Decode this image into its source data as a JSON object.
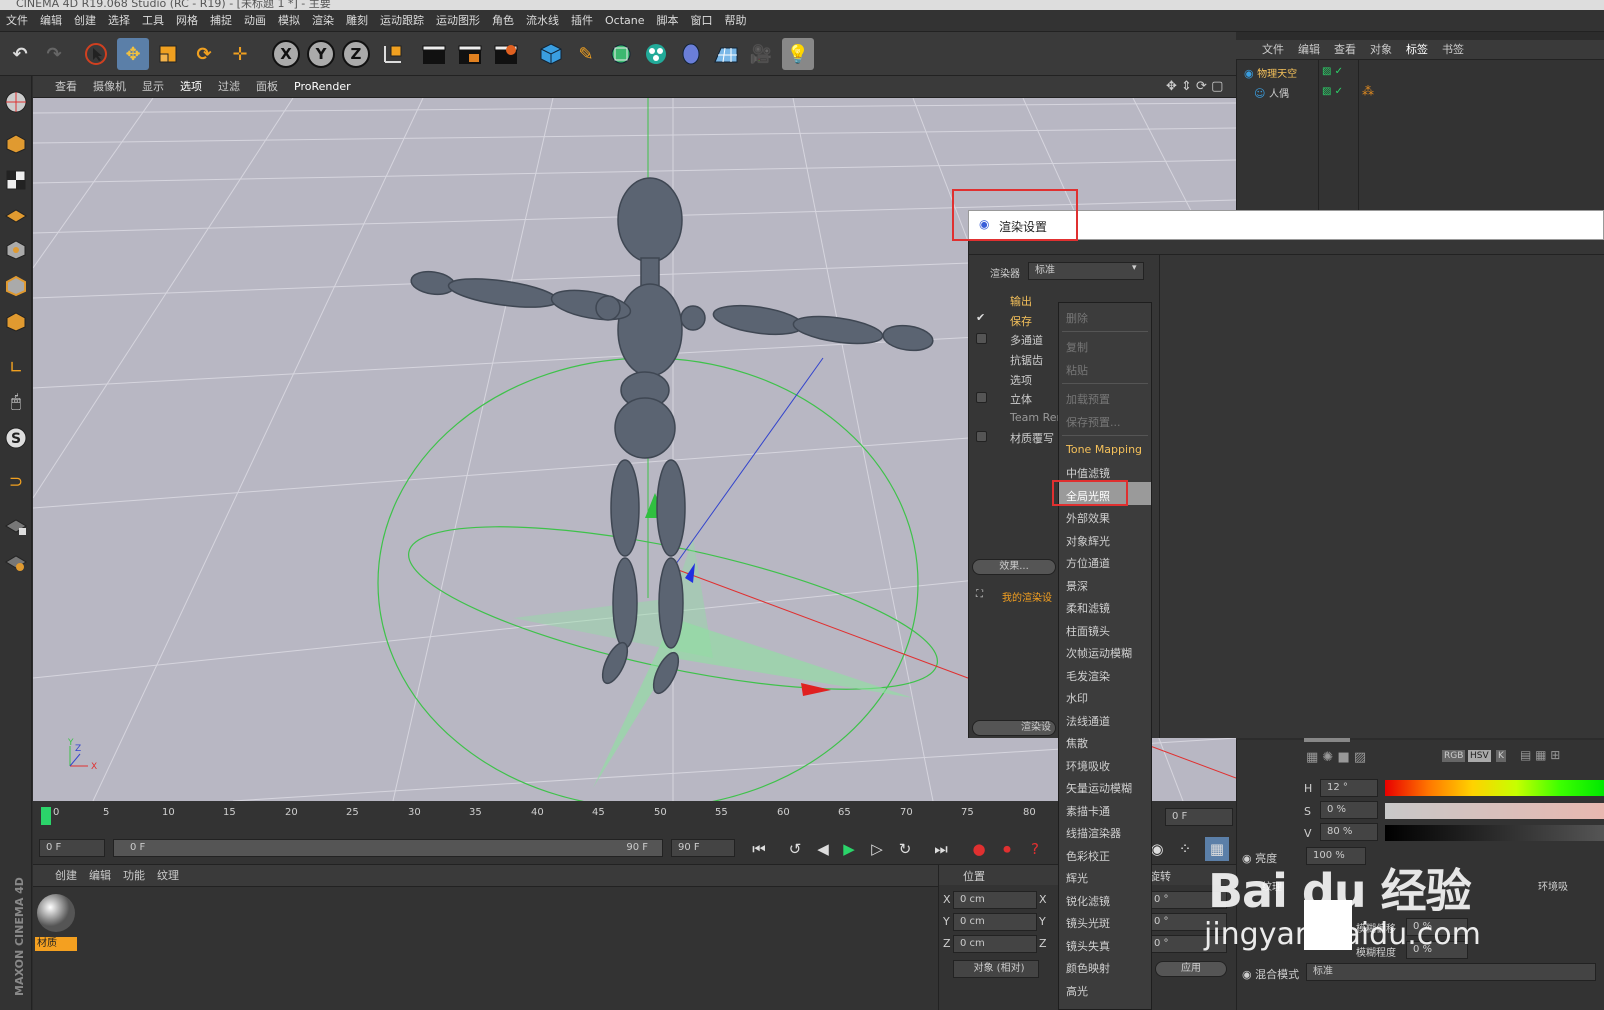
{
  "window": {
    "title": "CINEMA 4D R19.068 Studio (RC - R19) - [未标题 1 *] - 主要"
  },
  "menubar": [
    "文件",
    "编辑",
    "创建",
    "选择",
    "工具",
    "网格",
    "捕捉",
    "动画",
    "模拟",
    "渲染",
    "雕刻",
    "运动跟踪",
    "运动图形",
    "角色",
    "流水线",
    "插件",
    "Octane",
    "脚本",
    "窗口",
    "帮助"
  ],
  "toolbar": {
    "axis_labels": [
      "X",
      "Y",
      "Z"
    ]
  },
  "viewport": {
    "menu": [
      "查看",
      "摄像机",
      "显示",
      "选项",
      "过滤",
      "面板",
      "ProRender"
    ],
    "active_menu": "选项",
    "axis_gizmo": {
      "y": "Y",
      "z": "Z",
      "x": "X"
    }
  },
  "timeline": {
    "ticks": [
      "0",
      "5",
      "10",
      "15",
      "20",
      "25",
      "30",
      "35",
      "40",
      "45",
      "50",
      "55",
      "60",
      "65",
      "70",
      "75",
      "80"
    ],
    "current_frame": "0 F",
    "start_field": "0 F",
    "range_start": "0 F",
    "range_end": "90 F",
    "end_field": "90 F",
    "right_field": "0 F"
  },
  "material_panel": {
    "menu": [
      "创建",
      "编辑",
      "功能",
      "纹理"
    ],
    "material_label": "材质",
    "brand": "MAXON CINEMA 4D"
  },
  "coordinates": {
    "header_pos": "位置",
    "header_rot": "旋转",
    "rows": [
      {
        "axis": "X",
        "value": "0 cm",
        "axis2": "X",
        "rot": "0 °"
      },
      {
        "axis": "Y",
        "value": "0 cm",
        "axis2": "Y",
        "rot": "0 °"
      },
      {
        "axis": "Z",
        "value": "0 cm",
        "axis2": "Z",
        "rot": "0 °"
      }
    ],
    "mode": "对象 (相对)",
    "apply": "应用"
  },
  "object_manager": {
    "menu": [
      "文件",
      "编辑",
      "查看",
      "对象",
      "标签",
      "书签"
    ],
    "active_menu": "标签",
    "objects": [
      {
        "name": "物理天空",
        "highlight": true
      },
      {
        "name": "人偶",
        "highlight": false
      }
    ]
  },
  "render_settings": {
    "title": "渲染设置",
    "renderer_label": "渲染器",
    "renderer_value": "标准",
    "items": [
      {
        "label": "输出",
        "checked": null,
        "active": true
      },
      {
        "label": "保存",
        "checked": true,
        "active": true
      },
      {
        "label": "多通道",
        "checked": false,
        "active": false
      },
      {
        "label": "抗锯齿",
        "checked": null,
        "active": false
      },
      {
        "label": "选项",
        "checked": null,
        "active": false
      },
      {
        "label": "立体",
        "checked": false,
        "active": false
      },
      {
        "label": "Team Rer",
        "checked": null,
        "active": false
      },
      {
        "label": "材质覆写",
        "checked": false,
        "active": false
      }
    ],
    "effects_button": "效果...",
    "preset_name": "我的渲染设",
    "render_button": "渲染设"
  },
  "context_menu": {
    "group1": [
      "删除",
      "复制",
      "粘贴",
      "加载预置",
      "保存预置..."
    ],
    "tone_mapping": "Tone Mapping",
    "effects": [
      "中值滤镜",
      "全局光照",
      "外部效果",
      "对象辉光",
      "方位通道",
      "景深",
      "柔和滤镜",
      "柱面镜头",
      "次帧运动模糊",
      "毛发渲染",
      "水印",
      "法线通道",
      "焦散",
      "环境吸收",
      "矢量运动模糊",
      "素描卡通",
      "线描渲染器",
      "色彩校正",
      "辉光",
      "锐化滤镜",
      "镜头光斑",
      "镜头失真",
      "颜色映射",
      "高光"
    ],
    "highlighted": "全局光照"
  },
  "attributes": {
    "H_label": "H",
    "H_value": "12 °",
    "S_label": "S",
    "S_value": "0 %",
    "V_label": "V",
    "V_value": "80 %",
    "brightness_label": "亮度",
    "brightness_value": "100 %",
    "tex_label": "纹理",
    "env_label": "环境吸",
    "blur_offset_label": "模糊偏移",
    "blur_offset_value": "0 %",
    "blur_label": "模糊程度",
    "blur_value": "0 %",
    "blend_label": "混合模式",
    "blend_value": "标准",
    "mode_buttons": [
      "RGB",
      "HSV",
      "K"
    ]
  },
  "watermark": {
    "brand": "Bai du 经验",
    "url": "jingyan.baidu.com"
  },
  "colors": {
    "accent": "#f4c05a",
    "highlight_box": "#e03030",
    "selection": "#5b7fa8",
    "viewport_bg": "#b8b7c3"
  }
}
